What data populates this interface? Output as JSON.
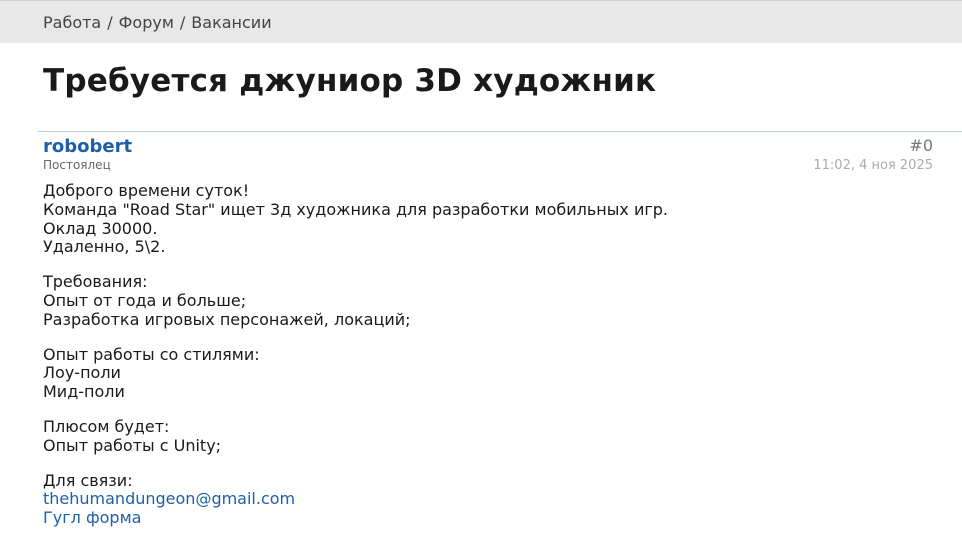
{
  "breadcrumb": {
    "items": [
      "Работа",
      "Форум",
      "Вакансии"
    ],
    "separator": "/"
  },
  "page_title": "Требуется джуниор 3D художник",
  "post": {
    "author": "robobert",
    "author_role": "Постоялец",
    "number": "#0",
    "date": "11:02, 4 ноя 2025",
    "paragraphs": [
      [
        "Доброго времени суток!",
        "Команда \"Road Star\" ищет 3д художника для разработки мобильных игр.",
        "Оклад 30000.",
        "Удаленно, 5\\2."
      ],
      [
        "Требования:",
        "Опыт от года и больше;",
        "Разработка игровых персонажей, локаций;"
      ],
      [
        "Опыт работы со стилями:",
        "Лоу-поли",
        "Мид-поли"
      ],
      [
        "Плюсом будет:",
        "Опыт работы с Unity;"
      ],
      [
        "Для связи:"
      ]
    ],
    "contact_email": "thehumandungeon@gmail.com",
    "contact_form": "Гугл форма"
  },
  "colors": {
    "link": "#1e5fa8",
    "breadcrumb_bg": "#e8e8e8",
    "divider": "#b9cfd6"
  }
}
